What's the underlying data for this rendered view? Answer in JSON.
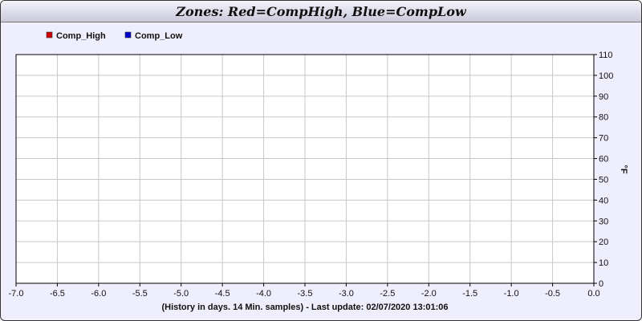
{
  "chart_data": {
    "type": "line",
    "title": "Zones: Red=CompHigh, Blue=CompLow",
    "xlabel": "(History in days. 14 Min. samples) - Last update: 02/07/2020 13:01:06",
    "ylabel": "°F",
    "xlim": [
      -7.0,
      0.0
    ],
    "ylim": [
      0,
      110
    ],
    "x_ticks": [
      "-7.0",
      "-6.5",
      "-6.0",
      "-5.5",
      "-5.0",
      "-4.5",
      "-4.0",
      "-3.5",
      "-3.0",
      "-2.5",
      "-2.0",
      "-1.5",
      "-1.0",
      "-0.5",
      "0.0"
    ],
    "y_ticks": [
      "0",
      "10",
      "20",
      "30",
      "40",
      "50",
      "60",
      "70",
      "80",
      "90",
      "100",
      "110"
    ],
    "grid": true,
    "legend_position": "top-left",
    "series": [
      {
        "name": "Comp_High",
        "color": "#cc0000",
        "x": [],
        "y": []
      },
      {
        "name": "Comp_Low",
        "color": "#0000cc",
        "x": [],
        "y": []
      }
    ]
  }
}
